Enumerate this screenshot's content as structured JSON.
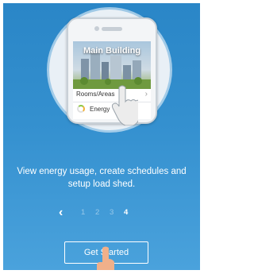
{
  "hero": {
    "building_title": "Main Building",
    "rooms_label": "Rooms/Areas",
    "rooms_chevron": "›",
    "energy_label": "Energy"
  },
  "description": "View energy usage, create schedules and setup load shed.",
  "pager": {
    "back_symbol": "‹",
    "pages": [
      "1",
      "2",
      "3",
      "4"
    ],
    "active_page": "4"
  },
  "cta": {
    "label": "Get Started"
  },
  "colors": {
    "background_top": "#2a86c7",
    "background_bottom": "#4aa2dc",
    "energy_green": "#8cc63f",
    "energy_orange": "#f2b134"
  },
  "icons": {
    "hand": "pointing-hand-icon",
    "tap": "tap-finger-icon",
    "energy": "energy-ring-icon"
  }
}
